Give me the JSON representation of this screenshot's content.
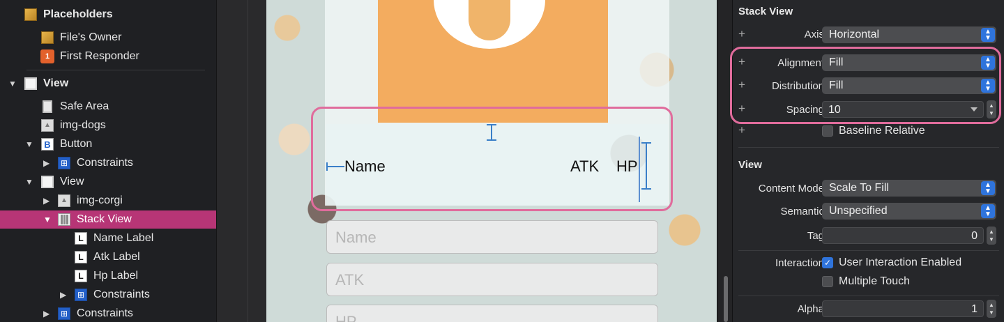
{
  "outline": {
    "placeholders_header": "Placeholders",
    "items": [
      {
        "label": "File's Owner"
      },
      {
        "label": "First Responder"
      },
      {
        "label": "View"
      },
      {
        "label": "Safe Area"
      },
      {
        "label": "img-dogs"
      },
      {
        "label": "Button"
      },
      {
        "label": "Constraints"
      },
      {
        "label": "View"
      },
      {
        "label": "img-corgi"
      },
      {
        "label": "Stack View"
      },
      {
        "label": "Name Label"
      },
      {
        "label": "Atk Label"
      },
      {
        "label": "Hp Label"
      },
      {
        "label": "Constraints"
      },
      {
        "label": "Constraints"
      }
    ]
  },
  "canvas": {
    "stack_labels": {
      "name": "Name",
      "atk": "ATK",
      "hp": "HP"
    },
    "fields": {
      "name": "Name",
      "atk": "ATK",
      "hp": "HP"
    }
  },
  "inspector": {
    "stack_view": {
      "title": "Stack View",
      "axis_label": "Axis",
      "axis_value": "Horizontal",
      "alignment_label": "Alignment",
      "alignment_value": "Fill",
      "distribution_label": "Distribution",
      "distribution_value": "Fill",
      "spacing_label": "Spacing",
      "spacing_value": "10",
      "baseline_label": "Baseline Relative",
      "baseline_checked": false
    },
    "view": {
      "title": "View",
      "content_mode_label": "Content Mode",
      "content_mode_value": "Scale To Fill",
      "semantic_label": "Semantic",
      "semantic_value": "Unspecified",
      "tag_label": "Tag",
      "tag_value": "0",
      "interaction_label": "Interaction",
      "user_interaction_label": "User Interaction Enabled",
      "user_interaction_checked": true,
      "multiple_touch_label": "Multiple Touch",
      "multiple_touch_checked": false,
      "alpha_label": "Alpha",
      "alpha_value": "1"
    }
  },
  "colors": {
    "selection": "#b73576",
    "highlight": "#e06c9c",
    "accent": "#2f74dc",
    "orange": "#f3ac5f"
  }
}
